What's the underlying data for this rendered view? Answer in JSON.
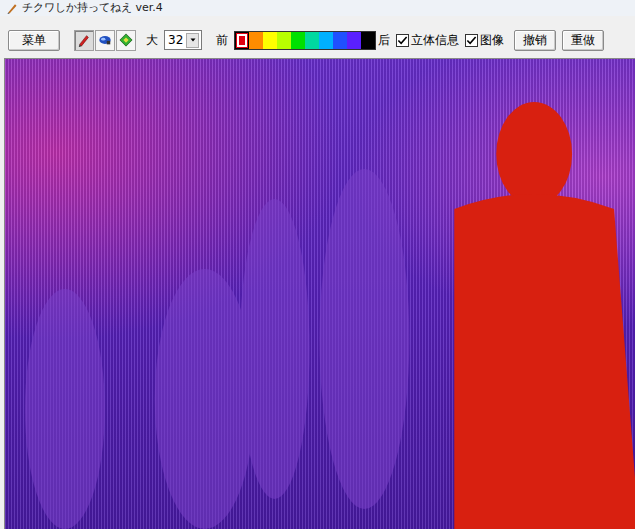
{
  "window": {
    "title": "チクワしか持ってねえ ver.4"
  },
  "toolbar": {
    "menu_button": "菜单",
    "tools": [
      {
        "name": "pen",
        "selected": true
      },
      {
        "name": "stereo",
        "selected": false
      },
      {
        "name": "fill",
        "selected": false
      }
    ],
    "size_label": "大",
    "size_value": "32",
    "front_label": "前",
    "colors": [
      {
        "color": "#e00010",
        "selected": true
      },
      {
        "color": "#ff8c00",
        "selected": false
      },
      {
        "color": "#ffff00",
        "selected": false
      },
      {
        "color": "#b8ff00",
        "selected": false
      },
      {
        "color": "#00e000",
        "selected": false
      },
      {
        "color": "#00d8a0",
        "selected": false
      },
      {
        "color": "#00b0ff",
        "selected": false
      },
      {
        "color": "#2050ff",
        "selected": false
      },
      {
        "color": "#5a20ff",
        "selected": false
      },
      {
        "color": "#000000",
        "selected": false
      }
    ],
    "back_label": "后",
    "checkboxes": [
      {
        "label": "立体信息",
        "checked": true
      },
      {
        "label": "图像",
        "checked": true
      }
    ],
    "undo_button": "撤销",
    "redo_button": "重做"
  }
}
